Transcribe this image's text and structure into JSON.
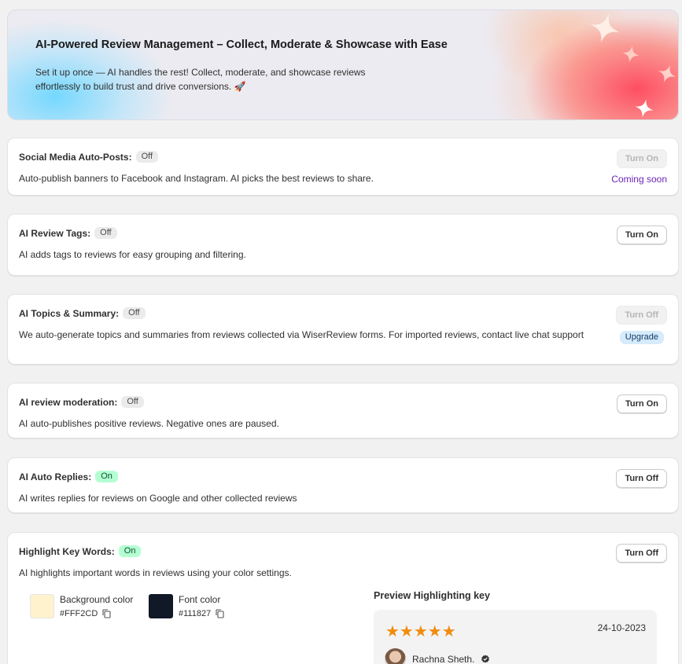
{
  "hero": {
    "title": "AI-Powered Review Management – Collect, Moderate & Showcase with Ease",
    "description": "Set it up once — AI handles the rest! Collect, moderate, and showcase reviews effortlessly to build trust and drive conversions. 🚀"
  },
  "features": [
    {
      "title": "Social Media Auto-Posts:",
      "status": "Off",
      "description": "Auto-publish banners to Facebook and Instagram. AI picks the best reviews to share.",
      "button": "Turn On",
      "note": "Coming soon"
    },
    {
      "title": "AI Review Tags:",
      "status": "Off",
      "description": "AI adds tags to reviews for easy grouping and filtering.",
      "button": "Turn On"
    },
    {
      "title": "AI Topics & Summary:",
      "status": "Off",
      "description": "We auto-generate topics and summaries from reviews collected via WiserReview forms. For imported reviews, contact live chat support",
      "button": "Turn Off",
      "note": "Upgrade"
    },
    {
      "title": "AI review moderation:",
      "status": "Off",
      "description": "AI auto-publishes positive reviews. Negative ones are paused.",
      "button": "Turn On"
    },
    {
      "title": "AI Auto Replies:",
      "status": "On",
      "description": "AI writes replies for reviews on Google and other collected reviews",
      "button": "Turn Off"
    },
    {
      "title": "Highlight Key Words:",
      "status": "On",
      "description": "AI highlights important words in reviews using your color settings.",
      "button": "Turn Off"
    }
  ],
  "highlight": {
    "background_label": "Background color",
    "background_value": "#FFF2CD",
    "font_label": "Font color",
    "font_value": "#111827",
    "preview_title": "Preview Highlighting key",
    "preview": {
      "stars": "★★★★★",
      "rating": 5,
      "date": "24-10-2023",
      "reviewer": "Rachna Sheth."
    }
  },
  "colors": {
    "on_badge": "#b4fed2",
    "off_badge": "#ebebeb",
    "coming_soon": "#6a24b8",
    "upgrade_badge": "#d6ebfb",
    "star": "#f08c0e"
  }
}
